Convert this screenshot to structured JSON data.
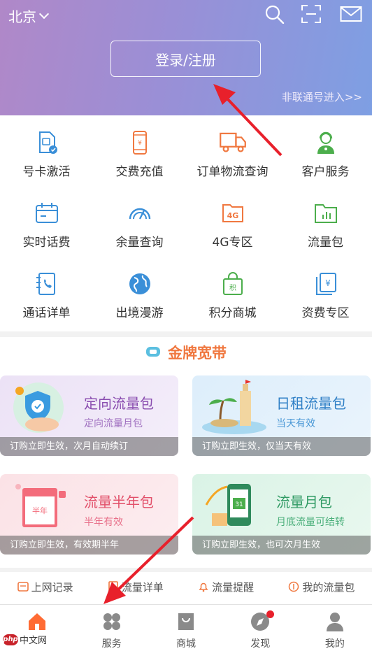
{
  "header": {
    "city": "北京",
    "login_label": "登录/注册",
    "non_unicom_label": "非联通号进入>>"
  },
  "grid": [
    {
      "label": "号卡激活",
      "icon": "sim-card-icon"
    },
    {
      "label": "交费充值",
      "icon": "phone-pay-icon"
    },
    {
      "label": "订单物流查询",
      "icon": "truck-icon"
    },
    {
      "label": "客户服务",
      "icon": "service-agent-icon"
    },
    {
      "label": "实时话费",
      "icon": "calendar-icon"
    },
    {
      "label": "余量查询",
      "icon": "gauge-icon"
    },
    {
      "label": "4G专区",
      "icon": "4g-icon"
    },
    {
      "label": "流量包",
      "icon": "folder-chart-icon"
    },
    {
      "label": "通话详单",
      "icon": "call-list-icon"
    },
    {
      "label": "出境漫游",
      "icon": "globe-icon"
    },
    {
      "label": "积分商城",
      "icon": "shopping-bag-icon"
    },
    {
      "label": "资费专区",
      "icon": "yuan-card-icon"
    }
  ],
  "section": {
    "title": "金牌宽带"
  },
  "cards": [
    {
      "title": "定向流量包",
      "subtitle": "定向流量月包",
      "footer": "订购立即生效，次月自动续订"
    },
    {
      "title": "日租流量包",
      "subtitle": "当天有效",
      "footer": "订购立即生效，仅当天有效"
    },
    {
      "title": "流量半年包",
      "subtitle": "半年有效",
      "footer": "订购立即生效，有效期半年"
    },
    {
      "title": "流量月包",
      "subtitle": "月底流量可结转",
      "footer": "订购立即生效，也可次月生效"
    }
  ],
  "quick_links": [
    "上网记录",
    "流量详单",
    "流量提醒",
    "我的流量包"
  ],
  "tabs": [
    {
      "label": "",
      "active": true
    },
    {
      "label": "服务",
      "active": false
    },
    {
      "label": "商城",
      "active": false
    },
    {
      "label": "发现",
      "active": false,
      "badge": true
    },
    {
      "label": "我的",
      "active": false
    }
  ],
  "watermark": {
    "logo": "php",
    "text": "中文网"
  },
  "colors": {
    "accent": "#ff6b34",
    "section_title": "#f07840",
    "header_start": "#b088c8",
    "header_end": "#7e9fe3"
  }
}
